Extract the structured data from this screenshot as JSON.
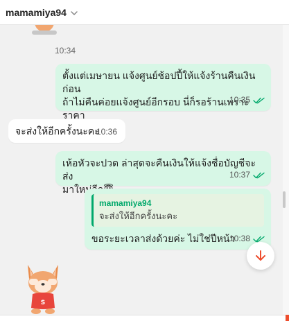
{
  "header": {
    "contact_name": "mamamiya94",
    "chevron_icon": "chevron-down-icon"
  },
  "colors": {
    "outgoing_bubble": "#d7f7e6",
    "incoming_bubble": "#ffffff",
    "accent": "#ee4d2d",
    "tick": "#00a86b"
  },
  "messages": [
    {
      "type": "timestamp",
      "time": "10:34"
    },
    {
      "type": "outgoing",
      "text": "ตั้งแต่เมษายน แจ้งศูนย์ช้อปปี้ให้แจ้งร้านคืนเงินก่อน\nถ้าไม่คืนค่อยแจ้งศูนย์อีกรอบ นี่ก็รอร้านเพราะราคา\nไม่กี่ร้อย",
      "time": "10:35",
      "status": "read"
    },
    {
      "type": "incoming",
      "text": "จะส่งให้อีกครั้งนะคะ",
      "time": "10:36"
    },
    {
      "type": "outgoing",
      "text": "เห้อหัวจะปวด ล่าสุดจะคืนเงินให้แจ้งชื่อบัญชีจะส่ง\nมาใหม่อีก😇",
      "time": "10:37",
      "status": "read"
    },
    {
      "type": "outgoing_reply",
      "quoted_name": "mamamiya94",
      "quoted_text": "จะส่งให้อีกครั้งนะคะ",
      "text": "ขอระยะเวลาส่งด้วยค่ะ ไม่ใช่ปีหน้า",
      "time": "10:38",
      "status": "read"
    }
  ],
  "scroll_button": {
    "icon": "arrow-down-icon"
  }
}
